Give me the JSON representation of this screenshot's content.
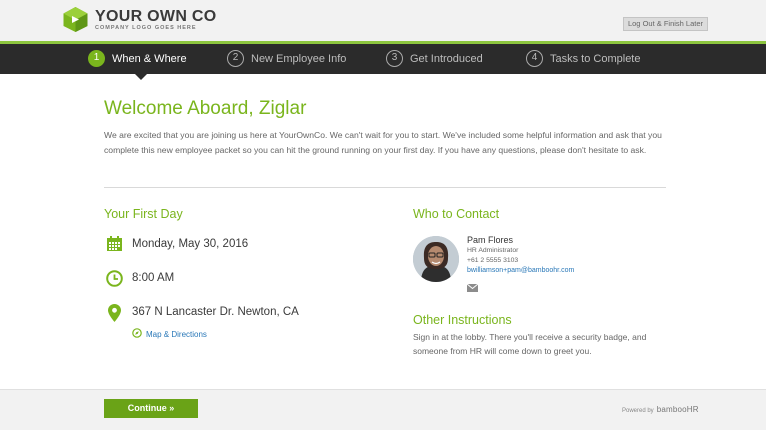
{
  "header": {
    "logo_name": "YOUR OWN CO",
    "logo_tagline": "COMPANY LOGO GOES HERE",
    "logout_label": "Log Out & Finish Later"
  },
  "steps": [
    {
      "num": "1",
      "label": "When & Where",
      "active": true
    },
    {
      "num": "2",
      "label": "New Employee Info",
      "active": false
    },
    {
      "num": "3",
      "label": "Get Introduced",
      "active": false
    },
    {
      "num": "4",
      "label": "Tasks to Complete",
      "active": false
    }
  ],
  "main": {
    "title": "Welcome Aboard, Ziglar",
    "intro": "We are excited that you are joining us here at YourOwnCo. We can't wait for you to start. We've included some helpful information and ask that you complete this new employee packet so you can hit the ground running on your first day. If you have any questions, please don't hesitate to ask."
  },
  "first_day": {
    "heading": "Your First Day",
    "date": "Monday, May 30, 2016",
    "time": "8:00 AM",
    "address": "367 N Lancaster Dr. Newton, CA",
    "map_link": "Map & Directions"
  },
  "contact": {
    "heading": "Who to Contact",
    "name": "Pam Flores",
    "role": "HR Administrator",
    "phone": "+61 2 5555 3103",
    "email": "bwilliamson+pam@bamboohr.com"
  },
  "other": {
    "heading": "Other Instructions",
    "text": "Sign in at the lobby. There you'll receive a security badge, and someone from HR will come down to greet you."
  },
  "footer": {
    "continue_label": "Continue »",
    "powered_by": "Powered by",
    "brand": "bambooHR"
  },
  "colors": {
    "accent": "#7ab51d",
    "dark_bar": "#2b2b2b",
    "link": "#2a78b8"
  }
}
